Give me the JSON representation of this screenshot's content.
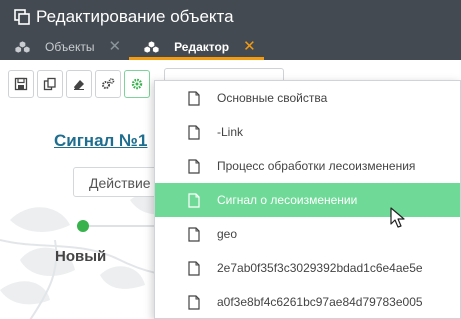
{
  "window": {
    "title": "Редактирование объекта",
    "title_icon": "copy-window-icon"
  },
  "tabs": [
    {
      "label": "Объекты",
      "icon": "cubes-icon",
      "close": "✕",
      "active": false
    },
    {
      "label": "Редактор",
      "icon": "cubes-icon",
      "close": "✕",
      "active": true
    }
  ],
  "toolbar": {
    "buttons": [
      "save-icon",
      "copy-icon",
      "eraser-icon",
      "gears-icon",
      "gear-icon"
    ]
  },
  "content": {
    "signal_title": "Сигнал №1",
    "actions_label": "Действие",
    "status_label": "Новый",
    "status_color": "#37b24d"
  },
  "dropdown": {
    "items": [
      {
        "label": "Основные свойства",
        "selected": false
      },
      {
        "label": "-Link",
        "selected": false
      },
      {
        "label": "Процесс обработки лесоизменения",
        "selected": false
      },
      {
        "label": "Сигнал о лесоизменении",
        "selected": true
      },
      {
        "label": "geo",
        "selected": false
      },
      {
        "label": "2e7ab0f35f3c3029392bdad1c6e4ae5e",
        "selected": false
      },
      {
        "label": "a0f3e8bf4c6261bc97ae84d79783e005",
        "selected": false
      }
    ],
    "selected_color": "#6fda97"
  },
  "colors": {
    "titlebar_bg": "#434a51",
    "tab_accent": "#f39c12",
    "link": "#1f6d8f"
  }
}
